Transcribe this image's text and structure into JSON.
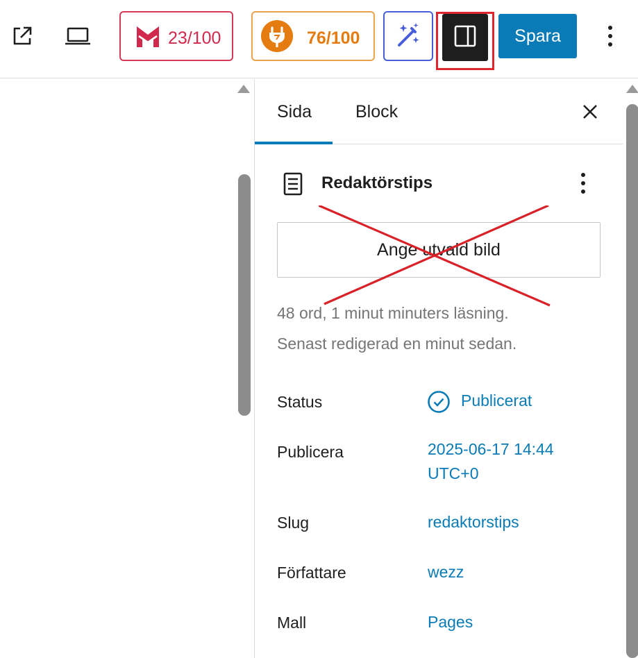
{
  "toolbar": {
    "external_link_icon": "external-link-icon",
    "preview_icon": "laptop-icon",
    "score_red": {
      "value": "23/100",
      "icon": "m-logo-icon",
      "color": "#d1294d"
    },
    "score_orange": {
      "value": "76/100",
      "icon": "plug-icon",
      "color": "#e57c12"
    },
    "ai_icon": "magic-wand-icon",
    "sidebar_toggle_icon": "sidebar-icon",
    "save_label": "Spara",
    "more_icon": "vertical-ellipsis-icon",
    "accent_color": "#0a7bb6"
  },
  "sidebar": {
    "tabs": [
      {
        "label": "Sida",
        "active": true
      },
      {
        "label": "Block",
        "active": false
      }
    ],
    "close_icon": "close-icon",
    "panel_title": "Redaktörstips",
    "panel_icon": "document-icon",
    "featured_image_label": "Ange utvald bild",
    "word_count": "48 ord, 1 minut minuters läsning.",
    "last_edited": "Senast redigerad en minut sedan.",
    "rows": [
      {
        "label": "Status",
        "value": "Publicerat"
      },
      {
        "label": "Publicera",
        "value_line1": "2025-06-17 14:44",
        "value_line2": "UTC+0"
      },
      {
        "label": "Slug",
        "value": "redaktorstips"
      },
      {
        "label": "Författare",
        "value": "wezz"
      },
      {
        "label": "Mall",
        "value": "Pages"
      }
    ]
  }
}
